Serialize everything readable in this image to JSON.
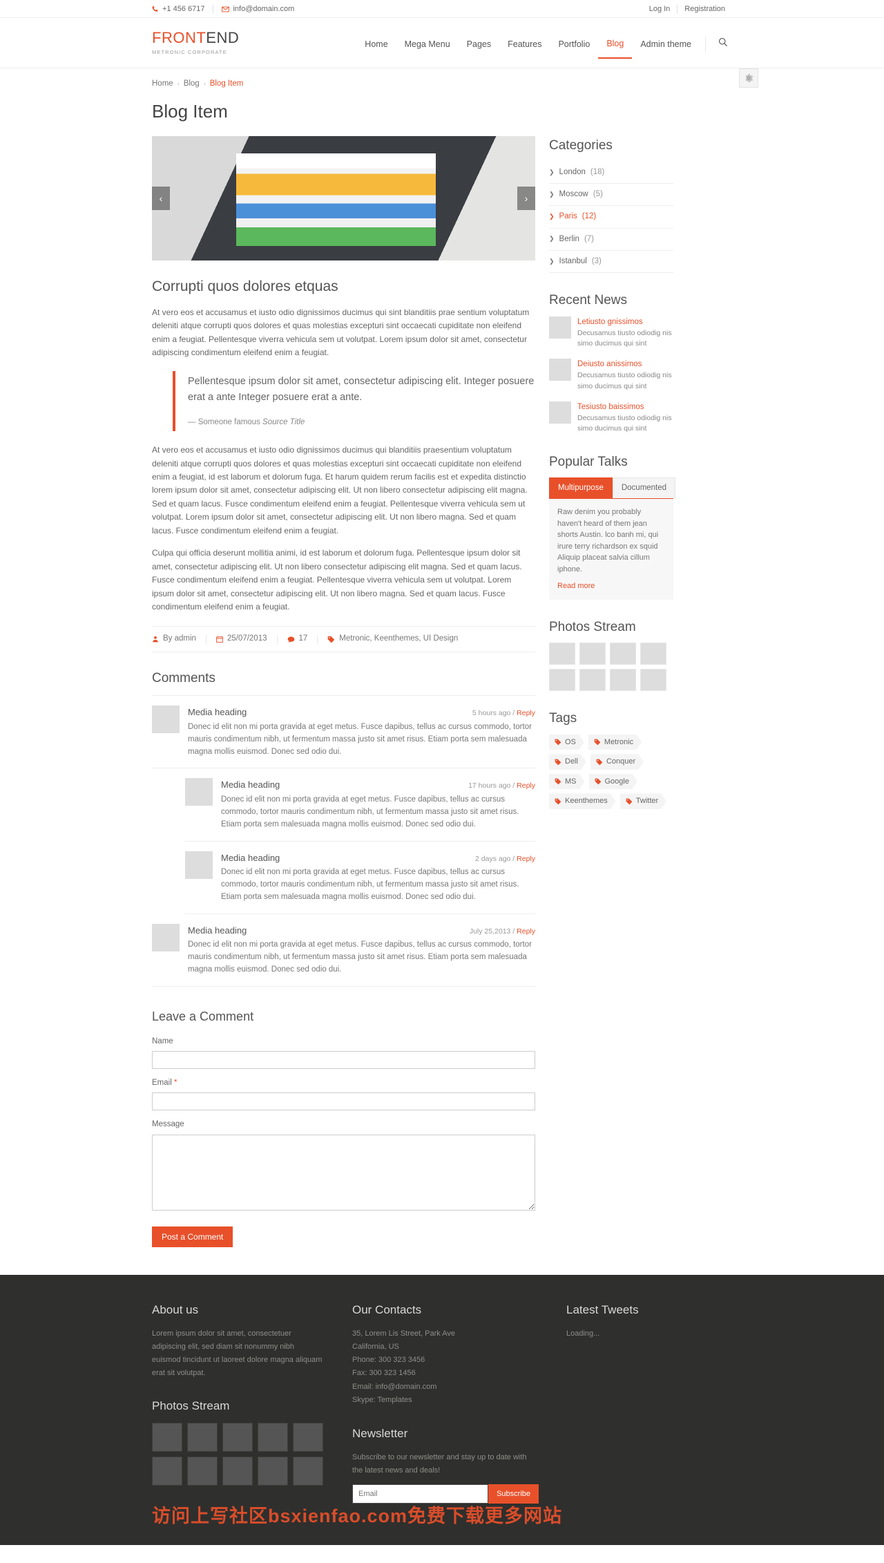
{
  "preheader": {
    "phone": "+1 456 6717",
    "email": "info@domain.com",
    "login": "Log In",
    "registration": "Registration"
  },
  "header": {
    "logo_a": "FRONT",
    "logo_b": "END",
    "logo_sub": "METRONIC CORPORATE",
    "nav": [
      {
        "label": "Home",
        "active": false
      },
      {
        "label": "Mega Menu",
        "active": false
      },
      {
        "label": "Pages",
        "active": false
      },
      {
        "label": "Features",
        "active": false
      },
      {
        "label": "Portfolio",
        "active": false
      },
      {
        "label": "Blog",
        "active": true
      },
      {
        "label": "Admin theme",
        "active": false
      }
    ]
  },
  "breadcrumb": {
    "home": "Home",
    "blog": "Blog",
    "current": "Blog Item",
    "separator": "›"
  },
  "page": {
    "title": "Blog Item"
  },
  "slider": {
    "prev": "‹",
    "next": "›"
  },
  "article": {
    "title": "Corrupti quos dolores etquas",
    "p1": "At vero eos et accusamus et iusto odio dignissimos ducimus qui sint blanditiis prae sentium voluptatum deleniti atque corrupti quos dolores et quas molestias excepturi sint occaecati cupiditate non eleifend enim a feugiat. Pellentesque viverra vehicula sem ut volutpat. Lorem ipsum dolor sit amet, consectetur adipiscing condimentum eleifend enim a feugiat.",
    "quote": "Pellentesque ipsum dolor sit amet, consectetur adipiscing elit. Integer posuere erat a ante Integer posuere erat a ante.",
    "quote_source_prefix": "— Someone famous ",
    "quote_source_title": "Source Title",
    "p2": "At vero eos et accusamus et iusto odio dignissimos ducimus qui blanditiis praesentium voluptatum deleniti atque corrupti quos dolores et quas molestias excepturi sint occaecati cupiditate non eleifend enim a feugiat, id est laborum et dolorum fuga. Et harum quidem rerum facilis est et expedita distinctio lorem ipsum dolor sit amet, consectetur adipiscing elit. Ut non libero consectetur adipiscing elit magna. Sed et quam lacus. Fusce condimentum eleifend enim a feugiat. Pellentesque viverra vehicula sem ut volutpat. Lorem ipsum dolor sit amet, consectetur adipiscing elit. Ut non libero magna. Sed et quam lacus. Fusce condimentum eleifend enim a feugiat.",
    "p3": "Culpa qui officia deserunt mollitia animi, id est laborum et dolorum fuga. Pellentesque ipsum dolor sit amet, consectetur adipiscing elit. Ut non libero consectetur adipiscing elit magna. Sed et quam lacus. Fusce condimentum eleifend enim a feugiat. Pellentesque viverra vehicula sem ut volutpat. Lorem ipsum dolor sit amet, consectetur adipiscing elit. Ut non libero magna. Sed et quam lacus. Fusce condimentum eleifend enim a feugiat."
  },
  "meta": {
    "author": "By admin",
    "date": "25/07/2013",
    "comments": "17",
    "tags": "Metronic, Keenthemes, UI Design"
  },
  "comments": {
    "title": "Comments",
    "items": [
      {
        "name": "Media heading",
        "when": "5 hours ago / ",
        "reply": "Reply",
        "text": "Donec id elit non mi porta gravida at eget metus. Fusce dapibus, tellus ac cursus commodo, tortor mauris condimentum nibh, ut fermentum massa justo sit amet risus. Etiam porta sem malesuada magna mollis euismod. Donec sed odio dui.",
        "nested": false
      },
      {
        "name": "Media heading",
        "when": "17 hours ago / ",
        "reply": "Reply",
        "text": "Donec id elit non mi porta gravida at eget metus. Fusce dapibus, tellus ac cursus commodo, tortor mauris condimentum nibh, ut fermentum massa justo sit amet risus. Etiam porta sem malesuada magna mollis euismod. Donec sed odio dui.",
        "nested": true
      },
      {
        "name": "Media heading",
        "when": "2 days ago / ",
        "reply": "Reply",
        "text": "Donec id elit non mi porta gravida at eget metus. Fusce dapibus, tellus ac cursus commodo, tortor mauris condimentum nibh, ut fermentum massa justo sit amet risus. Etiam porta sem malesuada magna mollis euismod. Donec sed odio dui.",
        "nested": true
      },
      {
        "name": "Media heading",
        "when": "July 25,2013 / ",
        "reply": "Reply",
        "text": "Donec id elit non mi porta gravida at eget metus. Fusce dapibus, tellus ac cursus commodo, tortor mauris condimentum nibh, ut fermentum massa justo sit amet risus. Etiam porta sem malesuada magna mollis euismod. Donec sed odio dui.",
        "nested": false
      }
    ]
  },
  "comment_form": {
    "title": "Leave a Comment",
    "name_label": "Name",
    "email_label": "Email ",
    "email_required": "*",
    "message_label": "Message",
    "name_value": "",
    "email_value": "",
    "message_value": "",
    "submit": "Post a Comment"
  },
  "sidebar": {
    "categories": {
      "title": "Categories",
      "items": [
        {
          "label": "London",
          "count": "(18)",
          "active": false
        },
        {
          "label": "Moscow",
          "count": "(5)",
          "active": false
        },
        {
          "label": "Paris",
          "count": "(12)",
          "active": true
        },
        {
          "label": "Berlin",
          "count": "(7)",
          "active": false
        },
        {
          "label": "Istanbul",
          "count": "(3)",
          "active": false
        }
      ]
    },
    "recent_news": {
      "title": "Recent News",
      "items": [
        {
          "title": "Letiusto gnissimos",
          "desc": "Decusamus tiusto odiodig nis simo ducimus qui sint"
        },
        {
          "title": "Deiusto anissimos",
          "desc": "Decusamus tiusto odiodig nis simo ducimus qui sint"
        },
        {
          "title": "Tesiusto baissimos",
          "desc": "Decusamus tiusto odiodig nis simo ducimus qui sint"
        }
      ]
    },
    "popular_talks": {
      "title": "Popular Talks",
      "tabs": [
        {
          "label": "Multipurpose",
          "active": true
        },
        {
          "label": "Documented",
          "active": false
        }
      ],
      "body": "Raw denim you probably haven't heard of them jean shorts Austin. lco banh mi, qui irure terry richardson ex squid Aliquip placeat salvia cillum iphone.",
      "read_more": "Read more"
    },
    "photos_stream": {
      "title": "Photos Stream",
      "count": 8
    },
    "tags": {
      "title": "Tags",
      "items": [
        "OS",
        "Metronic",
        "Dell",
        "Conquer",
        "MS",
        "Google",
        "Keenthemes",
        "Twitter"
      ]
    }
  },
  "footer": {
    "about": {
      "title": "About us",
      "text": "Lorem ipsum dolor sit amet, consectetuer adipiscing elit, sed diam sit nonummy nibh euismod tincidunt ut laoreet dolore magna aliquam erat sit volutpat."
    },
    "photos": {
      "title": "Photos Stream",
      "count": 10
    },
    "contacts": {
      "title": "Our Contacts",
      "lines": [
        "35, Lorem Lis Street, Park Ave",
        "California, US",
        "Phone: 300 323 3456",
        "Fax: 300 323 1456",
        "Email: info@domain.com",
        "Skype: Templates"
      ]
    },
    "newsletter": {
      "title": "Newsletter",
      "text": "Subscribe to our newsletter and stay up to date with the latest news and deals!",
      "placeholder": "Email",
      "button": "Subscribe"
    },
    "tweets": {
      "title": "Latest Tweets",
      "status": "Loading..."
    },
    "watermark": "访问上写社区bsxienfao.com免费下载更多网站"
  }
}
